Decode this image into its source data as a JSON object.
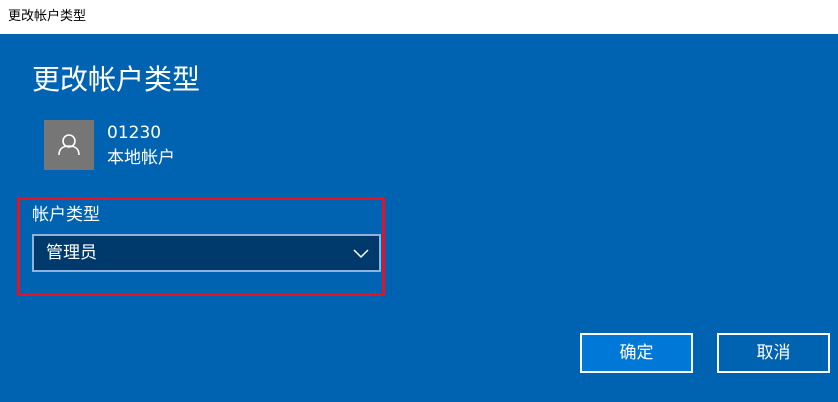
{
  "window": {
    "title": "更改帐户类型"
  },
  "dialog": {
    "heading": "更改帐户类型",
    "account": {
      "name": "01230",
      "kind": "本地帐户",
      "avatar_icon": "user-icon"
    },
    "account_type": {
      "label": "帐户类型",
      "selected": "管理员",
      "chevron_icon": "chevron-down-icon"
    },
    "buttons": {
      "ok_label": "确定",
      "cancel_label": "取消"
    }
  },
  "colors": {
    "background": "#0063b1",
    "titlebar": "#ffffff",
    "select_background": "#003a6c",
    "highlight_border": "#e81123",
    "ok_button": "#0078d7"
  }
}
